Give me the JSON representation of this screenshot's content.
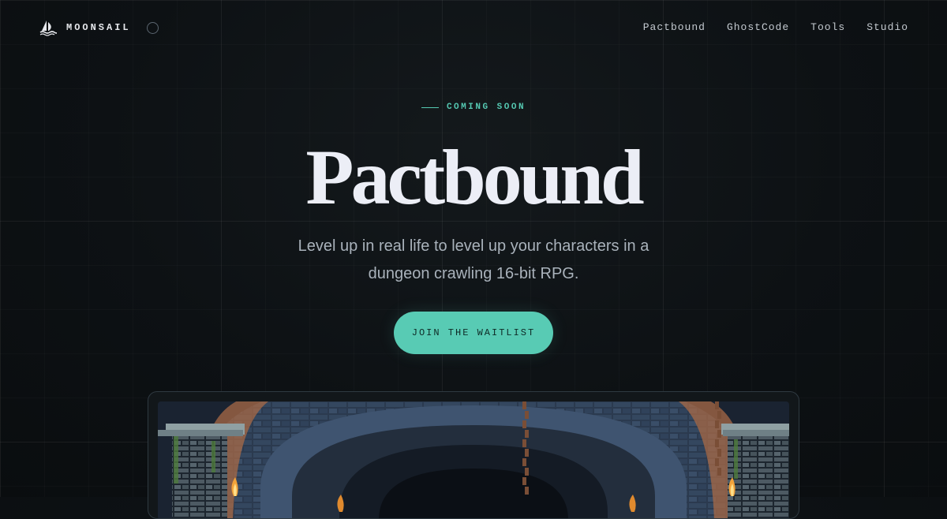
{
  "header": {
    "brand_name": "MOONSAIL",
    "nav": [
      {
        "label": "Pactbound"
      },
      {
        "label": "GhostCode"
      },
      {
        "label": "Tools"
      },
      {
        "label": "Studio"
      }
    ]
  },
  "hero": {
    "eyebrow": "COMING SOON",
    "title": "Pactbound",
    "subtitle_line1": "Level up in real life to level up your characters in a",
    "subtitle_line2": "dungeon crawling 16-bit RPG.",
    "cta_label": "JOIN THE WAITLIST"
  },
  "colors": {
    "accent": "#58cbb4",
    "background": "#0d1114",
    "title": "#eceef6",
    "subtitle": "#a9b2bb"
  },
  "icons": {
    "brand": "sailboat-icon",
    "theme_toggle": "moon-circle-icon",
    "screenshot": "pixel-dungeon-scene"
  }
}
